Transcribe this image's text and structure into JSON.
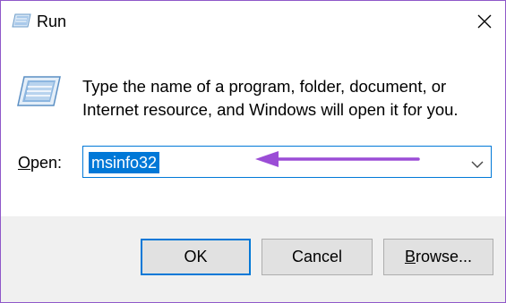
{
  "window": {
    "title": "Run",
    "close_glyph": "×"
  },
  "body": {
    "description_line1": "Type the name of a program, folder, document, or",
    "description_line2": "Internet resource, and Windows will open it for you."
  },
  "open_field": {
    "label_access_key": "O",
    "label_rest": "pen:",
    "value": "msinfo32",
    "dropdown_icon": "chevron-down-icon"
  },
  "annotation": {
    "arrow_color": "#9b4dd6"
  },
  "buttons": {
    "ok_label": "OK",
    "cancel_label": "Cancel",
    "browse_access_key": "B",
    "browse_rest": "rowse..."
  },
  "colors": {
    "accent": "#0078d7",
    "window_border": "#8f58c9",
    "footer_bg": "#f0f0f0",
    "button_bg": "#e1e1e1"
  },
  "icons": [
    "run-app-icon",
    "close-icon",
    "run-large-icon",
    "chevron-down-icon",
    "annotation-arrow-icon"
  ]
}
